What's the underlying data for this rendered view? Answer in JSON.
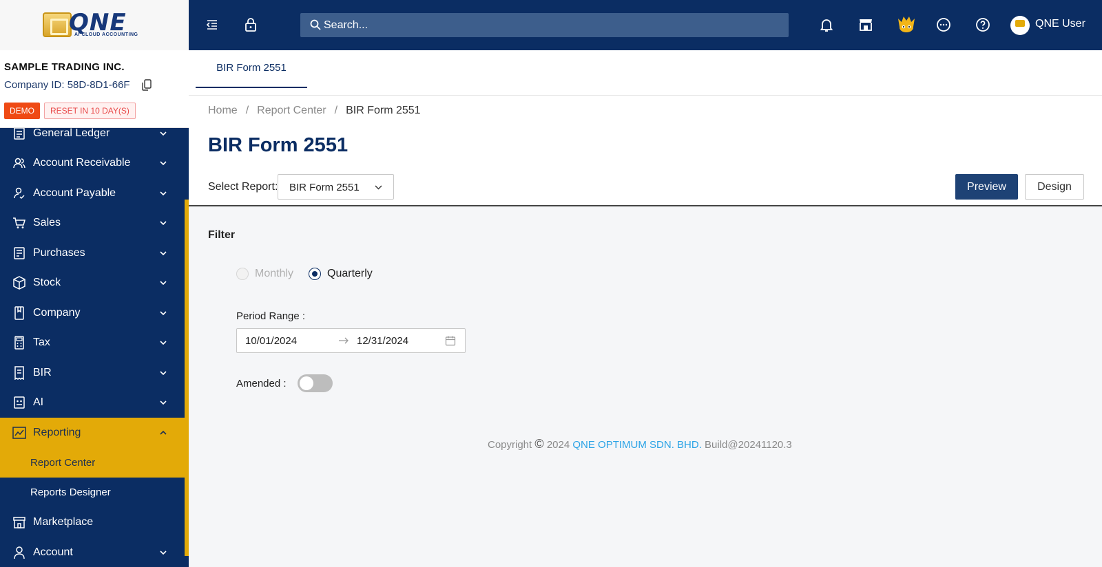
{
  "brand": {
    "logo_text": "QNE",
    "logo_subtext": "AI CLOUD ACCOUNTING"
  },
  "company": {
    "name": "SAMPLE TRADING INC.",
    "id_text": "Company ID: 58D-8D1-66F",
    "demo_badge": "DEMO",
    "reset_badge": "RESET IN 10 DAY(S)"
  },
  "sidebar": {
    "items": [
      {
        "label": "General Ledger",
        "icon": "ledger-icon",
        "expanded": false
      },
      {
        "label": "Account Receivable",
        "icon": "users-icon",
        "expanded": false
      },
      {
        "label": "Account Payable",
        "icon": "user-check-icon",
        "expanded": false
      },
      {
        "label": "Sales",
        "icon": "cart-icon",
        "expanded": false
      },
      {
        "label": "Purchases",
        "icon": "document-icon",
        "expanded": false
      },
      {
        "label": "Stock",
        "icon": "box-icon",
        "expanded": false
      },
      {
        "label": "Company",
        "icon": "book-icon",
        "expanded": false
      },
      {
        "label": "Tax",
        "icon": "calculator-icon",
        "expanded": false
      },
      {
        "label": "BIR",
        "icon": "receipt-icon",
        "expanded": false
      },
      {
        "label": "AI",
        "icon": "robot-icon",
        "expanded": false
      },
      {
        "label": "Reporting",
        "icon": "chart-line-icon",
        "expanded": true
      }
    ],
    "subitems": [
      {
        "label": "Report Center",
        "active": true
      },
      {
        "label": "Reports Designer",
        "active": false
      }
    ],
    "bottom_items": [
      {
        "label": "Marketplace",
        "icon": "store-icon",
        "expanded": null
      },
      {
        "label": "Account",
        "icon": "user-icon",
        "expanded": false
      }
    ],
    "accent_color": "#e3aa08",
    "background_color": "#0b2d63"
  },
  "topbar": {
    "search_placeholder": "Search...",
    "user_name": "QNE User",
    "icons": [
      "menu-fold-icon",
      "lock-icon",
      "bell-icon",
      "store-icon",
      "mascot-icon",
      "chat-icon",
      "help-icon"
    ]
  },
  "tabs": [
    {
      "label": "BIR Form 2551",
      "active": true
    }
  ],
  "breadcrumb": {
    "home": "Home",
    "section": "Report Center",
    "current": "BIR Form 2551",
    "separator": "/"
  },
  "page": {
    "title": "BIR Form 2551",
    "select_label": "Select Report:",
    "select_value": "BIR Form 2551",
    "preview_label": "Preview",
    "design_label": "Design"
  },
  "filter": {
    "title": "Filter",
    "period_options": [
      {
        "label": "Monthly",
        "selected": false,
        "disabled": true
      },
      {
        "label": "Quarterly",
        "selected": true,
        "disabled": false
      }
    ],
    "period_range_label": "Period Range :",
    "start_date": "10/01/2024",
    "end_date": "12/31/2024",
    "amended_label": "Amended :",
    "amended_on": false
  },
  "footer": {
    "copyright": "Copyright",
    "symbol": "©",
    "year": "2024",
    "company": "QNE OPTIMUM SDN. BHD.",
    "build": "Build@20241120.3"
  }
}
